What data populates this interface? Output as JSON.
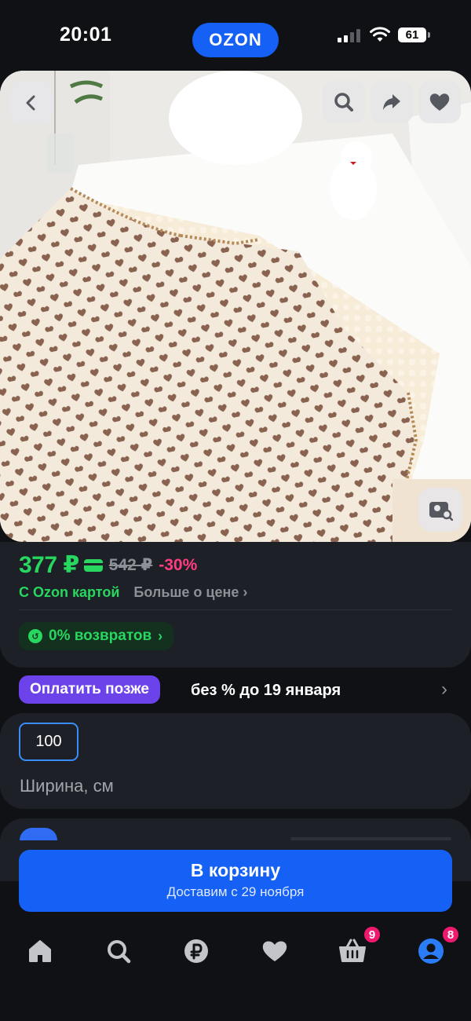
{
  "status_bar": {
    "time": "20:01",
    "app_logo": "OZON",
    "battery": "61",
    "icons": [
      "cellular-signal-icon",
      "wifi-icon",
      "battery-icon"
    ]
  },
  "product_image": {
    "overlay_buttons": [
      "back-icon",
      "search-icon",
      "share-icon",
      "heart-icon",
      "photo-search-icon"
    ]
  },
  "price": {
    "current": "377 ₽",
    "old": "542 ₽",
    "discount": "-30%",
    "with_card": "С Ozon картой",
    "more_about_price": "Больше о цене",
    "returns_label": "0% возвратов"
  },
  "pay_later": {
    "badge": "Оплатить позже",
    "text": "без % до 19 января"
  },
  "size": {
    "selected": "100",
    "label": "Ширина, см"
  },
  "cart_button": {
    "title": "В корзину",
    "subtitle": "Доставим с 29 ноября"
  },
  "bottom_nav": {
    "items": [
      {
        "icon": "home-icon",
        "badge": null
      },
      {
        "icon": "search-icon",
        "badge": null
      },
      {
        "icon": "ruble-icon",
        "badge": null
      },
      {
        "icon": "heart-icon",
        "badge": null
      },
      {
        "icon": "basket-icon",
        "badge": "9"
      },
      {
        "icon": "profile-icon",
        "badge": "8"
      }
    ]
  },
  "colors": {
    "background": "#0f1114",
    "card": "#1d2026",
    "brand_blue": "#1560f5",
    "price_green": "#27d75f",
    "discount_pink": "#ff3d80",
    "pay_later_purple": "#6c43ea",
    "badge_pink": "#f0196e"
  }
}
